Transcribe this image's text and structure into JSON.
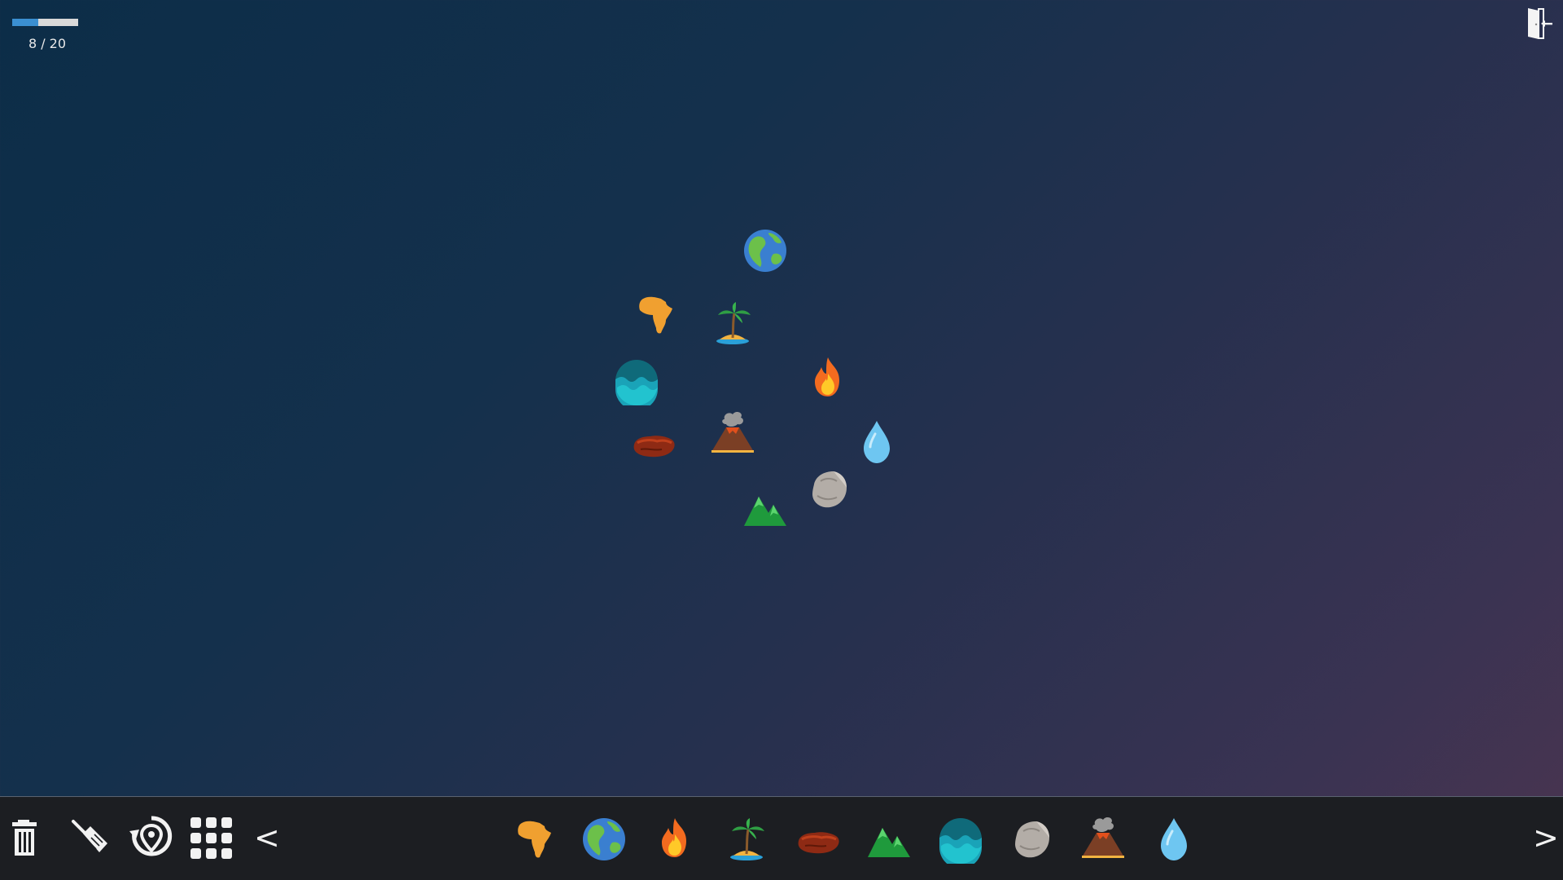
{
  "progress": {
    "text": "8 / 20",
    "fraction": 0.4
  },
  "header": {
    "exit_icon": "exit-door-icon"
  },
  "board": {
    "tiles": [
      {
        "name": "earth",
        "icon": "earth-globe-icon"
      },
      {
        "name": "africa",
        "icon": "africa-continent-icon"
      },
      {
        "name": "island",
        "icon": "palm-island-icon"
      },
      {
        "name": "sea",
        "icon": "sea-waves-icon"
      },
      {
        "name": "fire",
        "icon": "fire-icon"
      },
      {
        "name": "lava",
        "icon": "lava-rock-icon"
      },
      {
        "name": "volcano",
        "icon": "volcano-icon"
      },
      {
        "name": "water",
        "icon": "water-drop-icon"
      },
      {
        "name": "stone",
        "icon": "stone-icon"
      },
      {
        "name": "mountain",
        "icon": "mountain-icon"
      }
    ]
  },
  "toolbar": {
    "tools": [
      {
        "name": "delete",
        "icon": "trash-icon"
      },
      {
        "name": "clear",
        "icon": "broom-icon"
      },
      {
        "name": "reset-location",
        "icon": "location-reset-icon"
      },
      {
        "name": "grid",
        "icon": "grid-icon"
      }
    ],
    "prev_label": "<",
    "next_label": ">",
    "palette": [
      {
        "name": "africa",
        "icon": "africa-continent-icon"
      },
      {
        "name": "earth",
        "icon": "earth-globe-icon"
      },
      {
        "name": "fire",
        "icon": "fire-icon"
      },
      {
        "name": "island",
        "icon": "palm-island-icon"
      },
      {
        "name": "lava",
        "icon": "lava-rock-icon"
      },
      {
        "name": "mountain",
        "icon": "mountain-icon"
      },
      {
        "name": "sea",
        "icon": "sea-waves-icon"
      },
      {
        "name": "stone",
        "icon": "stone-icon"
      },
      {
        "name": "volcano",
        "icon": "volcano-icon"
      },
      {
        "name": "water",
        "icon": "water-drop-icon"
      }
    ]
  },
  "colors": {
    "progress_fill": "#3b8fd1",
    "progress_track": "#d9d9d9",
    "toolbar_bg": "#1c1e22"
  }
}
